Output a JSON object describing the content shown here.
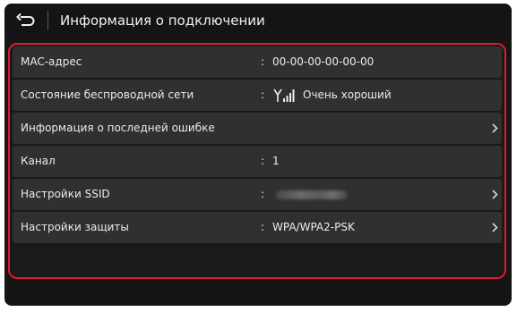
{
  "header": {
    "back_icon": "back-arrow-icon",
    "title": "Информация о подключении"
  },
  "rows": [
    {
      "label": "MAC-адрес",
      "colon": ":",
      "value": "00-00-00-00-00-00",
      "has_chevron": false
    },
    {
      "label": "Состояние беспроводной сети",
      "colon": ":",
      "value": "Очень хороший",
      "icon": "signal-strength-icon",
      "signal_level": "4 of 4 bars",
      "has_chevron": false
    },
    {
      "label": "Информация о последней ошибке",
      "has_chevron": true
    },
    {
      "label": "Канал",
      "colon": ":",
      "value": "1",
      "has_chevron": false
    },
    {
      "label": "Настройки SSID",
      "colon": ":",
      "value_obscured": true,
      "has_chevron": true
    },
    {
      "label": "Настройки защиты",
      "colon": ":",
      "value": "WPA/WPA2-PSK",
      "has_chevron": true
    }
  ],
  "colors": {
    "highlight_frame": "#e2182f",
    "screen_background": "#151515",
    "row_background": "#303030",
    "text": "#ebebeb"
  }
}
